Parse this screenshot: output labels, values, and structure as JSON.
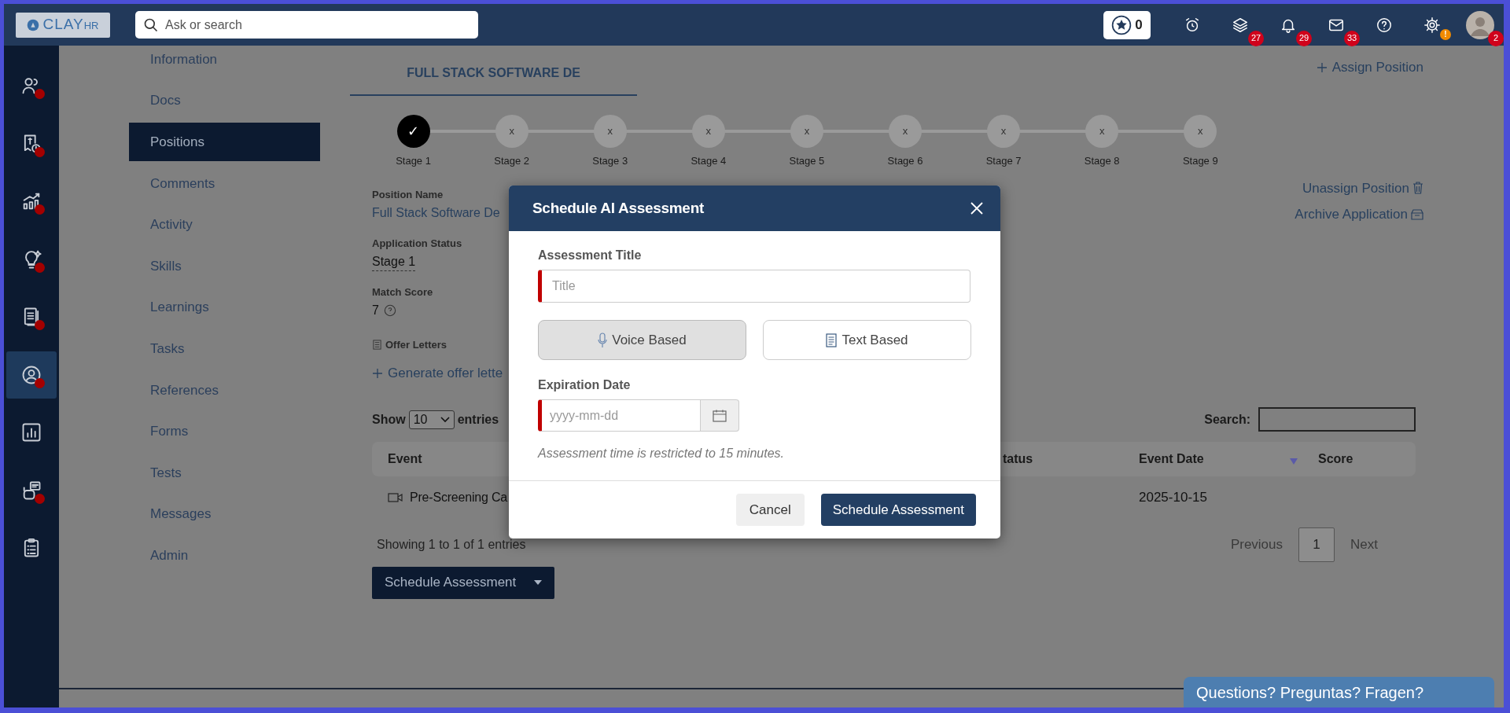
{
  "topbar": {
    "logo": "CLAY",
    "logo_suffix": "HR",
    "search_placeholder": "Ask or search",
    "points": "0",
    "icons": [
      {
        "kind": "alarm"
      },
      {
        "kind": "layers",
        "badge": "27",
        "color": "#d0021b"
      },
      {
        "kind": "bell",
        "badge": "29",
        "color": "#d0021b"
      },
      {
        "kind": "mail",
        "badge": "33",
        "color": "#d0021b"
      },
      {
        "kind": "help"
      },
      {
        "kind": "gear",
        "badge": "!",
        "color": "#f08a00"
      },
      {
        "kind": "avatar",
        "badge": "2",
        "color": "#d0021b"
      }
    ]
  },
  "rail": [
    {
      "kind": "users",
      "dot": true,
      "selected": false
    },
    {
      "kind": "billing",
      "dot": true,
      "selected": false
    },
    {
      "kind": "growth",
      "dot": true,
      "selected": false
    },
    {
      "kind": "idea",
      "dot": true,
      "selected": false
    },
    {
      "kind": "document",
      "dot": true,
      "selected": false
    },
    {
      "kind": "profile",
      "dot": true,
      "selected": true
    },
    {
      "kind": "chart",
      "dot": false,
      "selected": false
    },
    {
      "kind": "bot",
      "dot": true,
      "selected": false
    },
    {
      "kind": "clipboard",
      "dot": false,
      "selected": false
    }
  ],
  "nav": [
    {
      "label": "Information",
      "selected": false
    },
    {
      "label": "Docs",
      "selected": false
    },
    {
      "label": "Positions",
      "selected": true
    },
    {
      "label": "Comments",
      "selected": false
    },
    {
      "label": "Activity",
      "selected": false
    },
    {
      "label": "Skills",
      "selected": false
    },
    {
      "label": "Learnings",
      "selected": false
    },
    {
      "label": "Tasks",
      "selected": false
    },
    {
      "label": "References",
      "selected": false
    },
    {
      "label": "Forms",
      "selected": false
    },
    {
      "label": "Tests",
      "selected": false
    },
    {
      "label": "Messages",
      "selected": false
    },
    {
      "label": "Admin",
      "selected": false
    }
  ],
  "tabs": [
    {
      "label": "FULL STACK SOFTWARE DE",
      "selected": true
    }
  ],
  "assign_link": "Assign Position",
  "stages": [
    {
      "label": "Stage 1",
      "done": true,
      "mark": "✓"
    },
    {
      "label": "Stage 2",
      "done": false,
      "mark": "x"
    },
    {
      "label": "Stage 3",
      "done": false,
      "mark": "x"
    },
    {
      "label": "Stage 4",
      "done": false,
      "mark": "x"
    },
    {
      "label": "Stage 5",
      "done": false,
      "mark": "x"
    },
    {
      "label": "Stage 6",
      "done": false,
      "mark": "x"
    },
    {
      "label": "Stage 7",
      "done": false,
      "mark": "x"
    },
    {
      "label": "Stage 8",
      "done": false,
      "mark": "x"
    },
    {
      "label": "Stage 9",
      "done": false,
      "mark": "x"
    }
  ],
  "details": {
    "position_name_label": "Position Name",
    "position_name": "Full Stack Software De",
    "status_label": "Application Status",
    "status": "Stage 1",
    "match_label": "Match Score",
    "match": "7",
    "offer_label": "Offer Letters",
    "generate_link": "Generate offer lette"
  },
  "actions": [
    {
      "kind": "unassign",
      "label": "Unassign Position"
    },
    {
      "kind": "archive",
      "label": "Archive Application"
    }
  ],
  "table": {
    "show_label": "Show",
    "page_size": "10",
    "entries_label": "entries",
    "search_label": "Search:",
    "columns": [
      {
        "label": "Event",
        "sorted": false
      },
      {
        "label": "tatus",
        "sorted": false
      },
      {
        "label": "Event Date",
        "sorted": true
      },
      {
        "label": "Score",
        "sorted": false
      }
    ],
    "rows": [
      {
        "event": "Pre-Screening Ca",
        "event_date": "2025-10-15"
      }
    ],
    "info": "Showing 1 to 1 of 1 entries",
    "previous": "Previous",
    "pages": [
      {
        "label": "1",
        "selected": true
      }
    ],
    "next": "Next"
  },
  "schedule_button": "Schedule Assessment",
  "help_bar": "Questions? Preguntas? Fragen?",
  "modal": {
    "title": "Schedule AI Assessment",
    "title_label": "Assessment Title",
    "title_placeholder": "Title",
    "title_required": true,
    "types": [
      {
        "kind": "voice",
        "label": "Voice Based",
        "selected": true
      },
      {
        "kind": "text",
        "label": "Text Based",
        "selected": false
      }
    ],
    "date_label": "Expiration Date",
    "date_placeholder": "yyyy-mm-dd",
    "date_required": true,
    "note": "Assessment time is restricted to 15 minutes.",
    "cancel": "Cancel",
    "submit": "Schedule Assessment"
  }
}
